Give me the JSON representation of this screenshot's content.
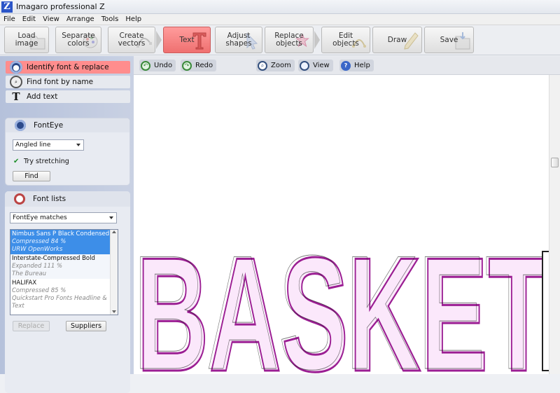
{
  "app": {
    "title": "Imagaro professional Z",
    "logo": "Z"
  },
  "menu": [
    "File",
    "Edit",
    "View",
    "Arrange",
    "Tools",
    "Help"
  ],
  "toolbar": {
    "buttons": [
      {
        "label": "Load\nimage",
        "icon": "folder-icon"
      },
      {
        "label": "Separate\ncolors",
        "icon": "palette-icon"
      },
      {
        "label": "Create\nvectors",
        "icon": "vector-icon"
      },
      {
        "label": "Text",
        "icon": "text-t-icon",
        "active": true
      },
      {
        "label": "Adjust\nshapes",
        "icon": "cursor-icon"
      },
      {
        "label": "Replace\nobjects",
        "icon": "star-icon"
      },
      {
        "label": "Edit\nobjects",
        "icon": "edit-nodes-icon"
      },
      {
        "label": "Draw",
        "icon": "pencil-icon"
      },
      {
        "label": "Save",
        "icon": "save-folder-icon"
      }
    ]
  },
  "left": {
    "nav": [
      {
        "label": "Identify font & replace",
        "icon": "eye-icon",
        "active": true
      },
      {
        "label": "Find font by name",
        "icon": "magnifier-icon"
      },
      {
        "label": "Add text",
        "icon": "text-t-icon"
      }
    ],
    "fonteye": {
      "title": "FontEye",
      "mode": "Angled line",
      "try_stretching_label": "Try stretching",
      "try_stretching": true,
      "find_label": "Find"
    },
    "fontlists": {
      "title": "Font lists",
      "source": "FontEye matches",
      "items": [
        {
          "name": "Nimbus Sans P Black Condensed",
          "detail": "Compressed 84 %",
          "vendor": "URW OpenWorks",
          "selected": true
        },
        {
          "name": "Interstate-Compressed Bold",
          "detail": "Expanded 111 %",
          "vendor": "The Bureau",
          "selected": false
        },
        {
          "name": "HALIFAX",
          "detail": "Compressed 85 %",
          "vendor": "Quickstart Pro Fonts Headline & Text",
          "selected": false
        }
      ],
      "replace_label": "Replace",
      "suppliers_label": "Suppliers"
    }
  },
  "subbar": {
    "undo": "Undo",
    "redo": "Redo",
    "zoom": "Zoom",
    "view": "View",
    "help": "Help"
  },
  "canvas": {
    "text": "BASKET"
  },
  "colors": {
    "accent": "#ff8d8d",
    "selection": "#3d8ee8",
    "glyph_outline": "#9b1e93",
    "glyph_fill": "#fbe8fb"
  }
}
